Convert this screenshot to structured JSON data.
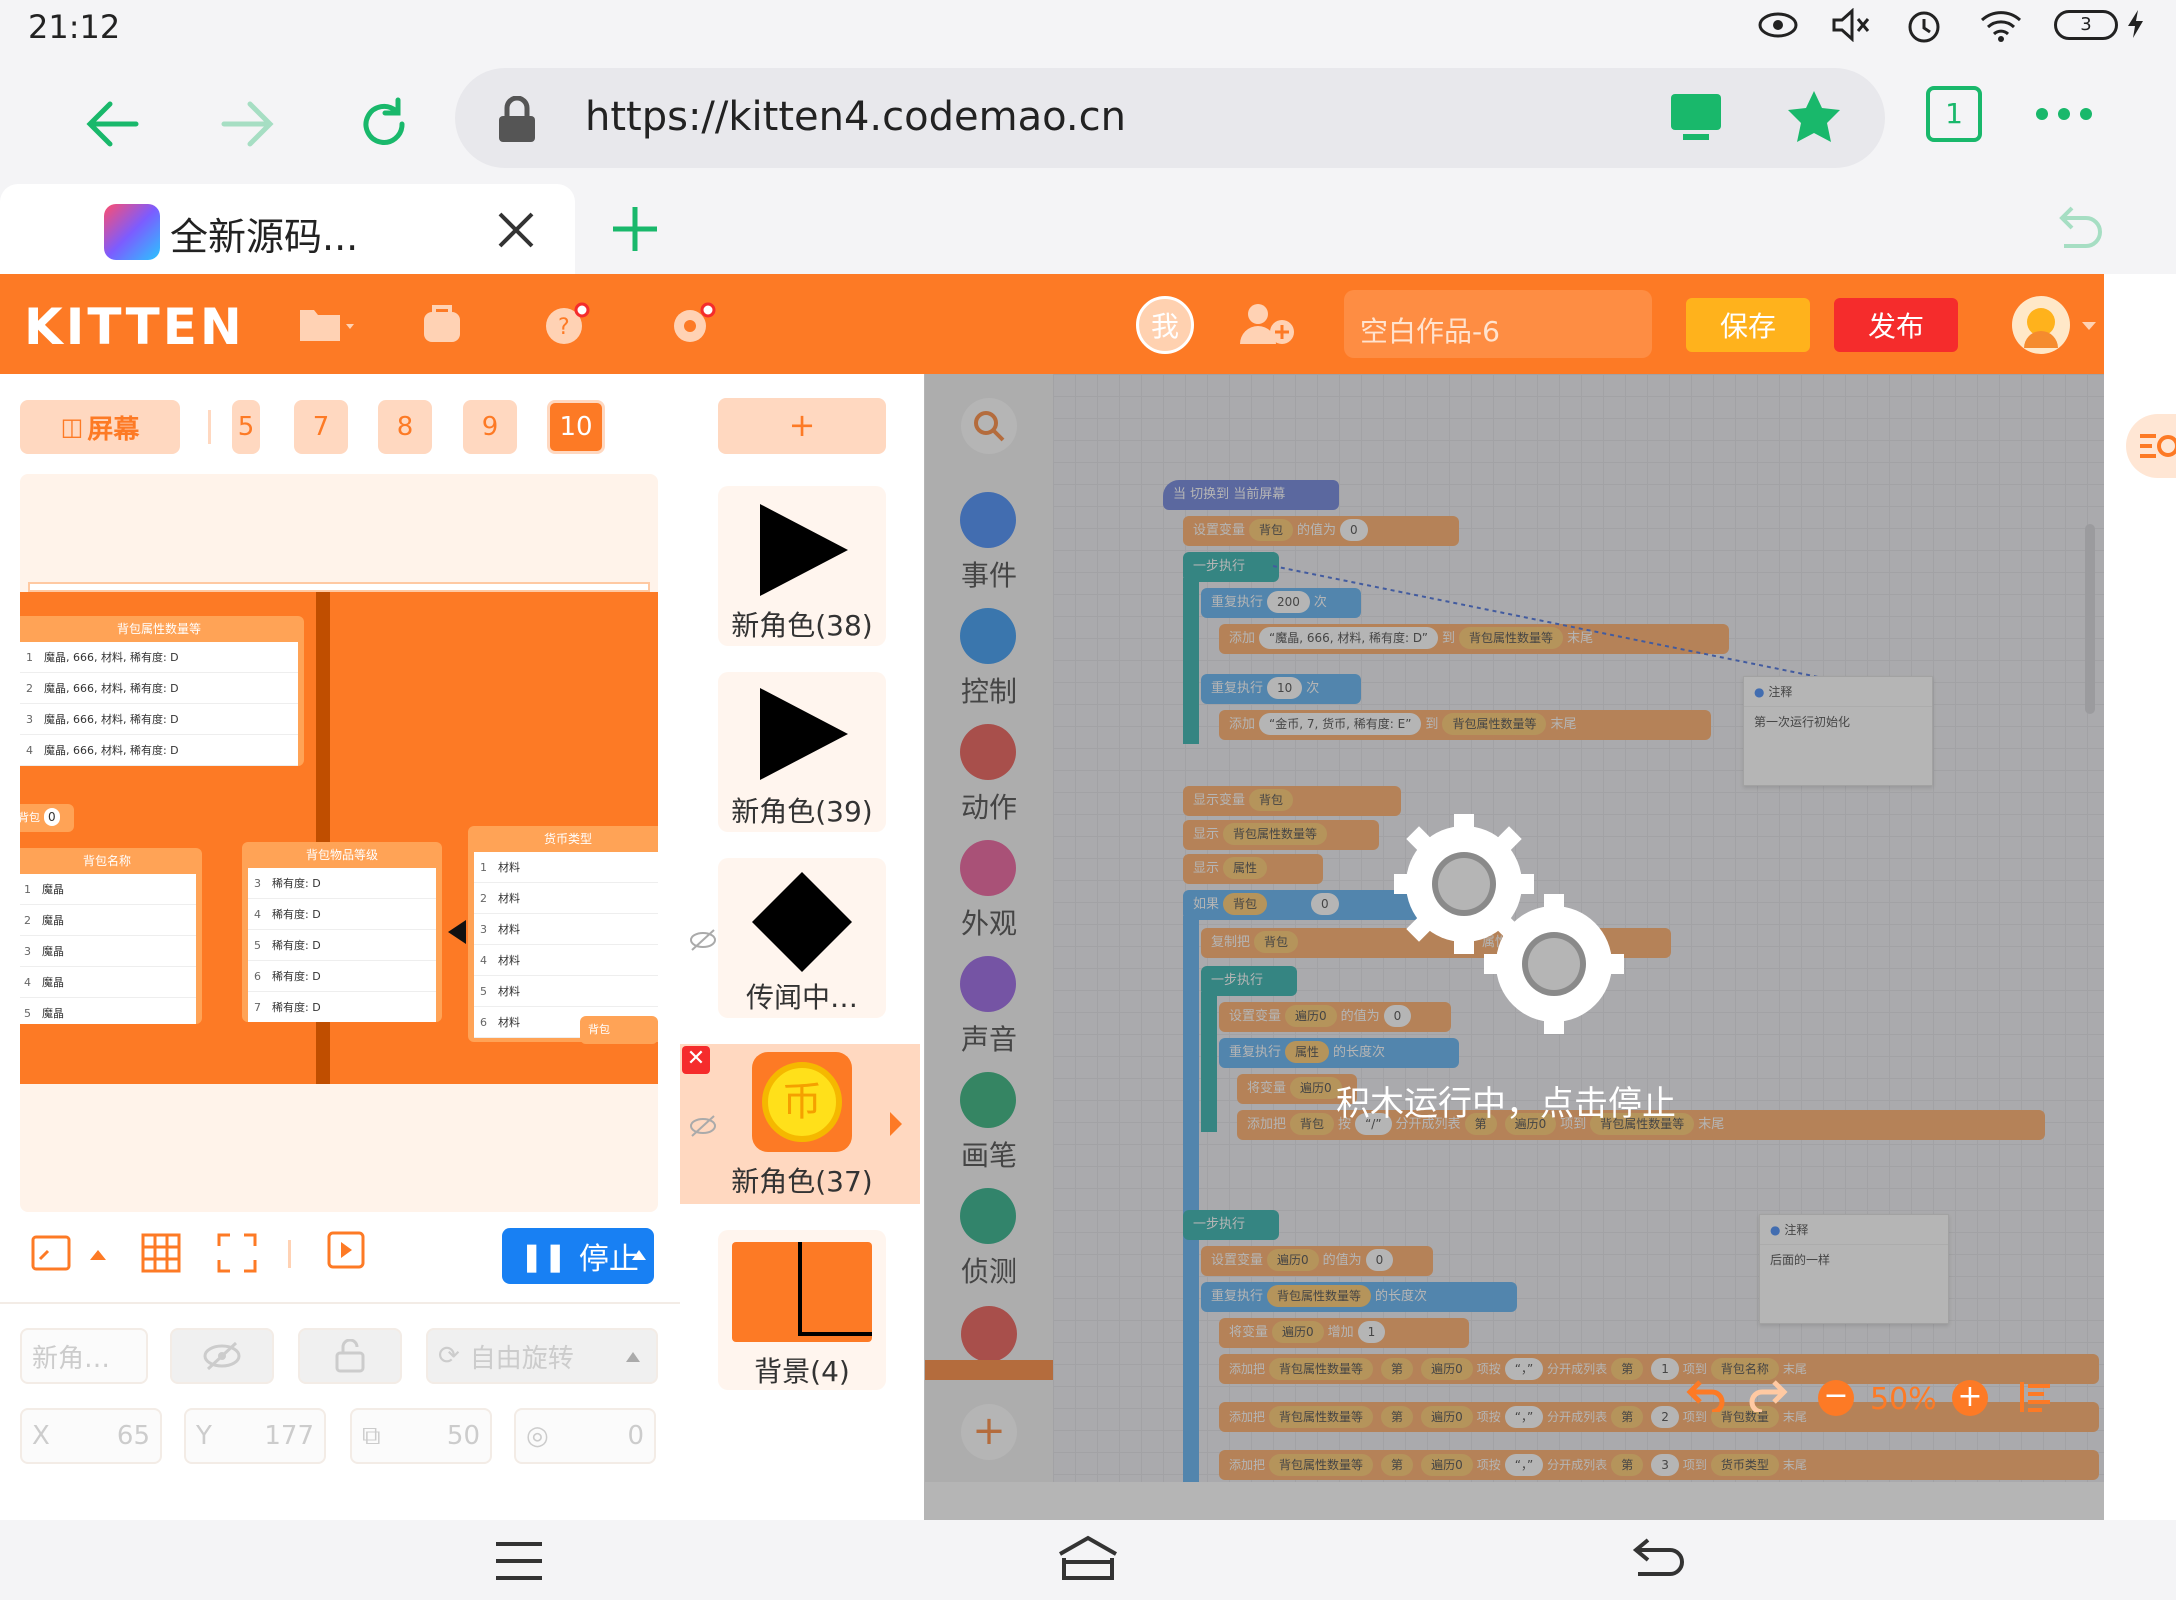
{
  "status_bar": {
    "time": "21:12",
    "battery": "3"
  },
  "browser": {
    "url": "https://kitten4.codemao.cn",
    "tab_count": "1",
    "tab_title": "全新源码..."
  },
  "kitten": {
    "logo": "KITTEN",
    "user_button": "我",
    "project_title": "空白作品-6",
    "save_label": "保存",
    "publish_label": "发布"
  },
  "screens": {
    "screen_button": "屏幕",
    "partial_tab": "5",
    "tabs": [
      "7",
      "8",
      "9",
      "10"
    ],
    "selected": "10"
  },
  "stage_lists": {
    "list1": {
      "title": "背包属性数量等",
      "rows": [
        {
          "n": "1",
          "v": "魔晶, 666, 材料, 稀有度: D"
        },
        {
          "n": "2",
          "v": "魔晶, 666, 材料, 稀有度: D"
        },
        {
          "n": "3",
          "v": "魔晶, 666, 材料, 稀有度: D"
        },
        {
          "n": "4",
          "v": "魔晶, 666, 材料, 稀有度: D"
        }
      ]
    },
    "var_label": "背包",
    "var_value": "0",
    "list2": {
      "title": "背包名称",
      "rows": [
        {
          "n": "1",
          "v": "魔晶"
        },
        {
          "n": "2",
          "v": "魔晶"
        },
        {
          "n": "3",
          "v": "魔晶"
        },
        {
          "n": "4",
          "v": "魔晶"
        },
        {
          "n": "5",
          "v": "魔晶"
        }
      ]
    },
    "list3": {
      "title": "背包物品等级",
      "rows": [
        {
          "n": "3",
          "v": "稀有度: D"
        },
        {
          "n": "4",
          "v": "稀有度: D"
        },
        {
          "n": "5",
          "v": "稀有度: D"
        },
        {
          "n": "6",
          "v": "稀有度: D"
        },
        {
          "n": "7",
          "v": "稀有度: D"
        }
      ]
    },
    "list4": {
      "title": "货币类型",
      "rows": [
        {
          "n": "1",
          "v": "材料"
        },
        {
          "n": "2",
          "v": "材料"
        },
        {
          "n": "3",
          "v": "材料"
        },
        {
          "n": "4",
          "v": "材料"
        },
        {
          "n": "5",
          "v": "材料"
        },
        {
          "n": "6",
          "v": "材料"
        }
      ]
    },
    "mini_var": "背包"
  },
  "stage_controls": {
    "stop_label": "停止"
  },
  "properties": {
    "name_placeholder": "新角…",
    "rotation_label": "自由旋转",
    "x_label": "X",
    "x": "65",
    "y_label": "Y",
    "y": "177",
    "size": "50",
    "direction": "0"
  },
  "sprites": {
    "add_label": "+",
    "items": [
      {
        "name": "新角色(38)"
      },
      {
        "name": "新角色(39)"
      },
      {
        "name": "传闻中…"
      },
      {
        "name": "新角色(37)"
      },
      {
        "name": "背景(4)"
      }
    ]
  },
  "categories": [
    {
      "label": "事件",
      "color": "#2e7cf6"
    },
    {
      "label": "控制",
      "color": "#1f8cf0"
    },
    {
      "label": "动作",
      "color": "#e8463f"
    },
    {
      "label": "外观",
      "color": "#e94a8e"
    },
    {
      "label": "声音",
      "color": "#8a4fe0"
    },
    {
      "label": "画笔",
      "color": "#17a86b"
    },
    {
      "label": "侦测",
      "color": "#12a779"
    }
  ],
  "code": {
    "hat": "当 切换到 当前屏幕",
    "b1": {
      "a": "设置变量",
      "var": "背包",
      "b": "的值为",
      "val": "0"
    },
    "step1": "一步执行",
    "rep1": {
      "a": "重复执行",
      "n": "200",
      "b": "次"
    },
    "add1": {
      "a": "添加",
      "v": "“魔晶, 666, 材料, 稀有度: D”",
      "b": "到",
      "list": "背包属性数量等",
      "c": "末尾"
    },
    "rep2": {
      "a": "重复执行",
      "n": "10",
      "b": "次"
    },
    "add2": {
      "a": "添加",
      "v": "“金币, 7, 货币, 稀有度: E”",
      "b": "到",
      "list": "背包属性数量等",
      "c": "末尾"
    },
    "show1": {
      "a": "显示",
      "b": "变量",
      "v": "背包"
    },
    "show2": {
      "a": "显示",
      "v": "背包属性数量等"
    },
    "show3": {
      "a": "显示",
      "v": "属性"
    },
    "if": {
      "a": "如果",
      "v": "背包",
      "val": "0"
    },
    "copy": {
      "a": "复制",
      "b": "把",
      "v": "背包",
      "c": "属性"
    },
    "step2": "一步执行",
    "set2": {
      "a": "设置变量",
      "v": "遍历0",
      "b": "的值为",
      "val": "0"
    },
    "rep3": {
      "a": "重复执行",
      "v": "属性",
      "b": "的长度",
      "c": "次"
    },
    "chg": {
      "a": "将变量",
      "v": "遍历0"
    },
    "add3": {
      "a": "添加",
      "b": "把",
      "v": "背包",
      "c": "按",
      "sep": "“/”",
      "d": "分开成列表",
      "e": "第",
      "idx": "遍历0",
      "f": "项",
      "g": "到",
      "list": "背包属性数量等",
      "h": "末尾"
    },
    "step3": "一步执行",
    "set3": {
      "a": "设置变量",
      "v": "遍历0",
      "b": "的值为",
      "val": "0"
    },
    "rep4": {
      "a": "重复执行",
      "v": "背包属性数量等",
      "b": "的长度",
      "c": "次"
    },
    "inc": {
      "a": "将变量",
      "v": "遍历0",
      "b": "增加",
      "val": "1"
    },
    "add4": {
      "a": "添加",
      "b": "把",
      "v": "背包属性数量等",
      "e": "第",
      "idx": "遍历0",
      "f": "项",
      "c": "按",
      "sep": "“，”",
      "d": "分开成列表",
      "k": "第",
      "n": "1",
      "m": "项",
      "g": "到",
      "list": "背包名称",
      "h": "末尾"
    },
    "add5": {
      "a": "添加",
      "b": "把",
      "v": "背包属性数量等",
      "e": "第",
      "idx": "遍历0",
      "f": "项",
      "c": "按",
      "sep": "“，”",
      "d": "分开成列表",
      "k": "第",
      "n": "2",
      "m": "项",
      "g": "到",
      "list": "背包数量",
      "h": "末尾"
    },
    "add6": {
      "a": "添加",
      "b": "把",
      "v": "背包属性数量等",
      "e": "第",
      "idx": "遍历0",
      "f": "项",
      "c": "按",
      "sep": "“，”",
      "d": "分开成列表",
      "k": "第",
      "n": "3",
      "m": "项",
      "g": "到",
      "list": "货币类型",
      "h": "末尾"
    },
    "note1": {
      "title": "注释",
      "text": "第一次运行初始化"
    },
    "note2": {
      "title": "注释",
      "text": "后面的一样"
    },
    "zoom": "50%"
  },
  "overlay_text": "积木运行中，点击停止"
}
